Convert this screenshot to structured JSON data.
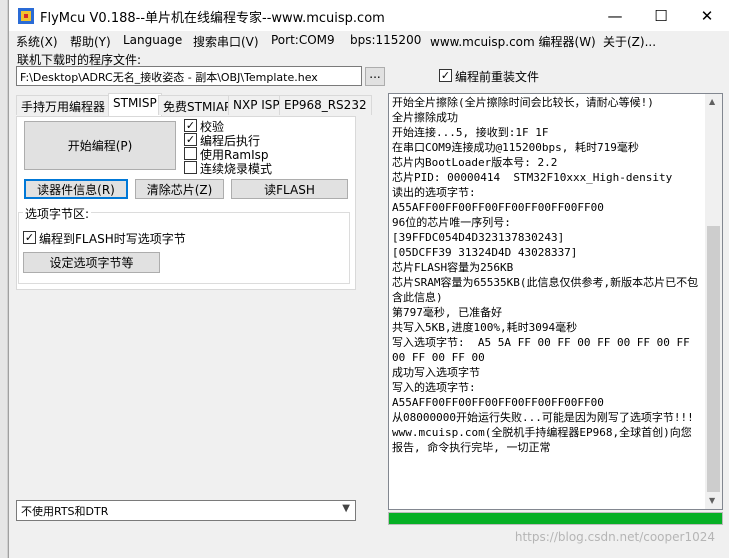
{
  "window": {
    "title": "FlyMcu V0.188--单片机在线编程专家--www.mcuisp.com",
    "minimize": "—",
    "maximize": "☐",
    "close": "✕"
  },
  "menu": [
    "系统(X)",
    "帮助(Y)",
    "Language",
    "搜索串口(V)",
    "Port:COM9",
    "bps:115200",
    "www.mcuisp.com 编程器(W)",
    "关于(Z)..."
  ],
  "file": {
    "label": "联机下载时的程序文件:",
    "path": "F:\\Desktop\\ADRC无名_接收姿态 - 副本\\OBJ\\Template.hex",
    "browse": "...",
    "reload_label": "编程前重装文件",
    "reload_checked": "✓"
  },
  "tabs": [
    "手持万用编程器",
    "STMISP",
    "免费STMIAP",
    "NXP ISP",
    "EP968_RS232"
  ],
  "stmisp": {
    "start_button": "开始编程(P)",
    "options": [
      {
        "label": "校验",
        "checked": "✓"
      },
      {
        "label": "编程后执行",
        "checked": "✓"
      },
      {
        "label": "使用RamIsp",
        "checked": ""
      },
      {
        "label": "连续烧录模式",
        "checked": ""
      }
    ],
    "read_info_button": "读器件信息(R)",
    "erase_button": "清除芯片(Z)",
    "read_flash_button": "读FLASH",
    "option_group_title": "选项字节区:",
    "write_option_label": "编程到FLASH时写选项字节",
    "write_option_checked": "✓",
    "set_option_button": "设定选项字节等"
  },
  "rts_dtr_select": "不使用RTS和DTR",
  "log_lines": [
    "开始全片擦除(全片擦除时间会比较长，请耐心等候!)",
    "全片擦除成功",
    "开始连接...5, 接收到:1F 1F",
    "在串口COM9连接成功@115200bps, 耗时719毫秒",
    "芯片内BootLoader版本号: 2.2",
    "芯片PID: 00000414  STM32F10xxx_High-density",
    "读出的选项字节:",
    "A55AFF00FF00FF00FF00FF00FF00FF00",
    "96位的芯片唯一序列号:",
    "[39FFDC054D4D323137830243]",
    "[05DCFF39 31324D4D 43028337]",
    "芯片FLASH容量为256KB",
    "芯片SRAM容量为65535KB(此信息仅供参考,新版本芯片已不包含此信息)",
    "第797毫秒, 已准备好",
    "共写入5KB,进度100%,耗时3094毫秒",
    "写入选项字节:  A5 5A FF 00 FF 00 FF 00 FF 00 FF 00 FF 00 FF 00",
    "成功写入选项字节",
    "写入的选项字节:",
    "A55AFF00FF00FF00FF00FF00FF00FF00",
    "从08000000开始运行失败...可能是因为刚写了选项字节!!!",
    "www.mcuisp.com(全脱机手持编程器EP968,全球首创)向您报告, 命令执行完毕, 一切正常"
  ],
  "progress": 1.0,
  "watermark": "https://blog.csdn.net/cooper1024",
  "colors": {
    "progress": "#06b025",
    "focus": "#0078d7"
  }
}
